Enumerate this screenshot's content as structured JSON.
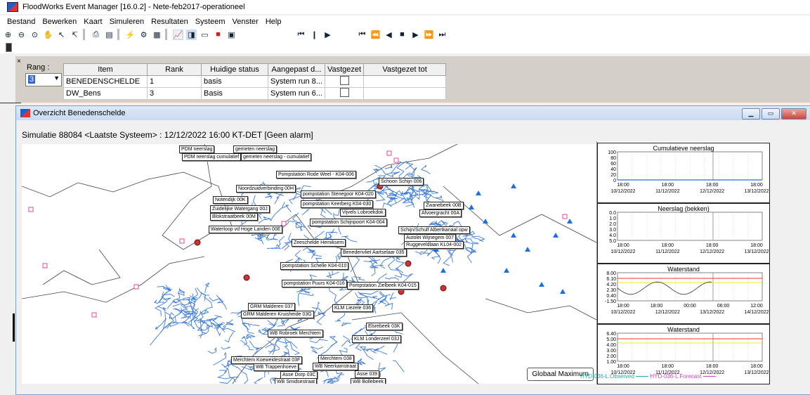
{
  "app": {
    "title": "FloodWorks Event Manager [16.0.2] - Nete-feb2017-operationeel"
  },
  "menu": [
    "Bestand",
    "Bewerken",
    "Kaart",
    "Simuleren",
    "Resultaten",
    "Systeem",
    "Venster",
    "Help"
  ],
  "rank_panel": {
    "close_label": "×",
    "rang_label": "Rang :",
    "rang_value": "3",
    "columns": [
      "Item",
      "Rank",
      "Huidige status",
      "Aangepast d...",
      "Vastgezet",
      "Vastgezet tot"
    ],
    "rows": [
      {
        "item": "BENEDENSCHELDE",
        "rank": "1",
        "status": "basis",
        "aangepast": "System run 8..."
      },
      {
        "item": "DW_Bens",
        "rank": "3",
        "status": "Basis",
        "aangepast": "System run 6..."
      }
    ]
  },
  "window": {
    "title": "Overzicht Benedenschelde",
    "simulation": "Simulatie 88084 <Laatste Systeem> : 12/12/2022 16:00  KT-DET [Geen alarm]",
    "globaal_button": "Globaal Maximum"
  },
  "map_labels": [
    "PDM neerslag",
    "gemeten neerslag",
    "PDM neerslag cumulatief",
    "gemeten neerslag - cumulatief",
    "Pompstation Rode Weel - K04-006",
    "Noordzuidverbinding 00H",
    "Schoon Schijn 006",
    "pompstation Stenegoor K04-020",
    "pompstation Keerberg K04-030",
    "Notendijk 00K",
    "Zuidelijke Watergang 00J",
    "Blokstraatbeek 00M",
    "Vijvels Lobroekdok",
    "Zwanebeek 00B",
    "Afvoergracht 00A",
    "pompstation Schijnpoort K04-004",
    "Waterloop vd Hoge Landen 00E",
    "Schijn/Schulf Albertkanaal opw",
    "Autolei Wijnegem 007",
    "Ruggeveldlaan KL04-002",
    "Zeeschelde Hemiksem",
    "Benedenvliet Aartselaar 035",
    "pompstation Schelle K04-010",
    "pompstation Puurs K04-016",
    "Pompstation Zielbeek K04-015",
    "GRM Malderen 037",
    "GRM Malderen Kruisheide 03G",
    "KLM Liezele 036",
    "Elsrebeek 03K",
    "WB Robroek Merchtem",
    "KLM Londerzeel 03J",
    "Merchtem Koeweidestraat 03F",
    "Merchtem 038",
    "WB Trappenhoeve",
    "WB Neerkamstraat",
    "Asse 039",
    "Asse Dorp 03C",
    "WB Smidsestraat",
    "WB Bollebeek"
  ],
  "charts": [
    {
      "title": "Cumulatieve neerslag",
      "yticks": [
        "100",
        "80",
        "60",
        "40",
        "20",
        "0"
      ],
      "xticks": [
        "18:00",
        "18:00",
        "18:00",
        "18:00"
      ],
      "xdates": [
        "10/12/2022",
        "11/12/2022",
        "12/12/2022",
        "13/12/2022"
      ]
    },
    {
      "title": "Neerslag (bekken)",
      "yticks": [
        "0.0",
        "1.0",
        "2.0",
        "3.0",
        "4.0",
        "5.0"
      ],
      "xticks": [
        "18:00",
        "18:00",
        "18:00",
        "18:00"
      ],
      "xdates": [
        "10/12/2022",
        "11/12/2022",
        "12/12/2022",
        "13/12/2022"
      ]
    },
    {
      "title": "Waterstand",
      "yticks": [
        "8.00",
        "6.10",
        "4.20",
        "2.30",
        "0.40",
        "-1.50"
      ],
      "xticks": [
        "18:00",
        "18:00",
        "00:00",
        "06:00",
        "12:00"
      ],
      "xdates": [
        "10/12/2022",
        "12/12/2022",
        "13/12/2022",
        "14/12/2022"
      ]
    },
    {
      "title": "Waterstand",
      "yticks": [
        "6.40",
        "5.00",
        "4.00",
        "3.00",
        "2.00",
        "1.00"
      ],
      "xticks": [
        "18:00",
        "18:00",
        "18:00",
        "18:00"
      ],
      "xdates": [
        "10/12/2022",
        "11/12/2022",
        "12/12/2022",
        "13/12/2022"
      ]
    }
  ],
  "legend": {
    "observed": "HYD-036-L:Observed",
    "forecast": "HYD-036-L Forecast"
  },
  "colors": {
    "river": "#3a7ad9",
    "accent": "#316ac5",
    "forecast": "#cc44cc",
    "observed": "#22aaaa",
    "alarm_red": "#ee3333",
    "alarm_yellow": "#eeee22"
  }
}
